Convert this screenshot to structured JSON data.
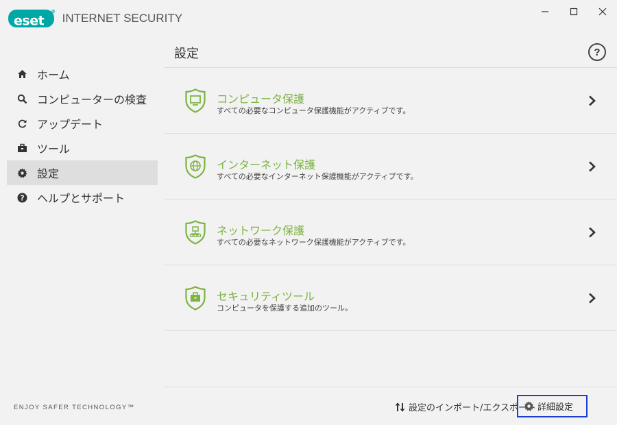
{
  "app": {
    "logo_text": "eset",
    "logo_reg": "®",
    "product_name": "INTERNET SECURITY"
  },
  "window_controls": {
    "minimize_icon": "minimize-icon",
    "maximize_icon": "maximize-icon",
    "close_icon": "close-icon"
  },
  "sidebar": {
    "items": [
      {
        "label": "ホーム",
        "icon": "home-icon",
        "active": false
      },
      {
        "label": "コンピューターの検査",
        "icon": "search-icon",
        "active": false
      },
      {
        "label": "アップデート",
        "icon": "refresh-icon",
        "active": false
      },
      {
        "label": "ツール",
        "icon": "toolbox-icon",
        "active": false
      },
      {
        "label": "設定",
        "icon": "gear-icon",
        "active": true
      },
      {
        "label": "ヘルプとサポート",
        "icon": "help-icon",
        "active": false
      }
    ],
    "tagline": "ENJOY SAFER TECHNOLOGY™"
  },
  "main": {
    "title": "設定",
    "help_label": "?",
    "cards": [
      {
        "title": "コンピュータ保護",
        "description": "すべての必要なコンピュータ保護機能がアクティブです。",
        "icon": "shield-monitor-icon"
      },
      {
        "title": "インターネット保護",
        "description": "すべての必要なインターネット保護機能がアクティブです。",
        "icon": "shield-globe-icon"
      },
      {
        "title": "ネットワーク保護",
        "description": "すべての必要なネットワーク保護機能がアクティブです。",
        "icon": "shield-network-icon"
      },
      {
        "title": "セキュリティツール",
        "description": "コンピュータを保護する追加のツール。",
        "icon": "shield-toolbox-icon"
      }
    ],
    "footer": {
      "import_export_label": "設定のインポート/エクスポート",
      "advanced_label": "詳細設定"
    }
  },
  "colors": {
    "brand": "#00a7a7",
    "accent_green": "#7cb342",
    "focus_border": "#1a3fd1"
  }
}
